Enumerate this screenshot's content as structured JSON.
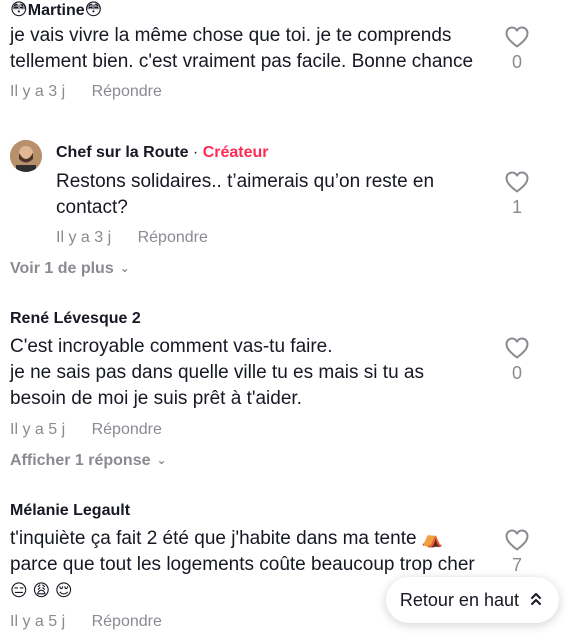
{
  "comments": [
    {
      "author": "Martine",
      "author_emoji_left": "😳",
      "author_emoji_right": "😳",
      "text": "je vais vivre la même chose que toi. je te comprends tellement bien. c'est vraiment pas facile. Bonne chance",
      "time": "Il y a 3 j",
      "reply_label": "Répondre",
      "likes": "0",
      "reply": {
        "author": "Chef sur la Route",
        "separator": " · ",
        "tag": "Créateur",
        "text": "Restons solidaires.. t’aimerais qu’on reste en contact?",
        "time": "Il y a 3 j",
        "reply_label": "Répondre",
        "likes": "1"
      },
      "more_label": "Voir 1 de plus"
    },
    {
      "author": "René Lévesque 2",
      "text_line1": "C'est incroyable comment vas-tu faire.",
      "text_line2": "je ne sais pas dans quelle ville tu es mais si tu as besoin de moi je suis prêt à t'aider.",
      "time": "Il y a 5 j",
      "reply_label": "Répondre",
      "likes": "0",
      "more_label": "Afficher 1 réponse"
    },
    {
      "author": "Mélanie Legault",
      "text_part1": "t'inquiète ça fait 2 été que j'habite dans ma tente",
      "tent_emoji": "⛺",
      "text_part2": " parce que tout les logements coûte beaucoup trop cher",
      "end_emojis": "😑 😩 😌",
      "time": "Il y a 5 j",
      "reply_label": "Répondre",
      "likes": "7"
    }
  ],
  "back_to_top": {
    "label": "Retour en haut",
    "icon": "chevron-double-up-icon"
  },
  "colors": {
    "text": "#161823",
    "muted": "#8a8b91",
    "creator": "#fe2c55"
  }
}
